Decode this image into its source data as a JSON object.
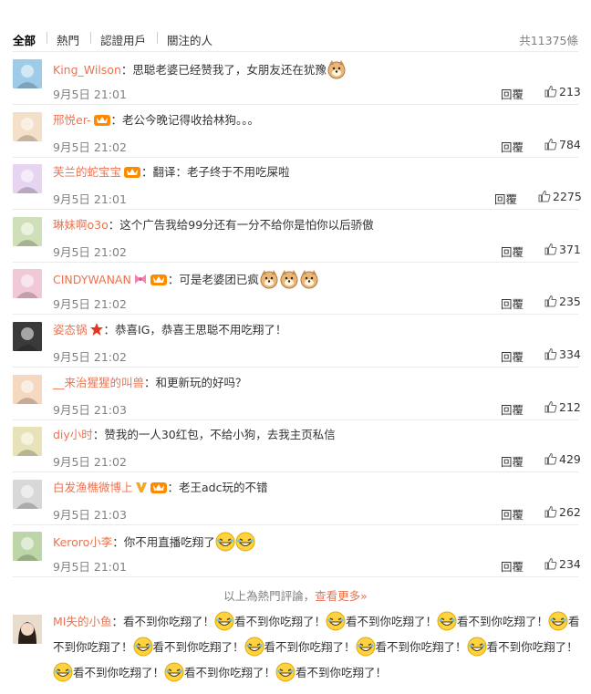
{
  "tabs": [
    "全部",
    "熱門",
    "認證用戶",
    "關注的人"
  ],
  "total": "共11375條",
  "reply_label": "回覆",
  "comments": [
    {
      "user": "King_Wilson",
      "text": "：思聪老婆已经赞我了，女朋友还在犹豫",
      "emojis": 1,
      "badges": [],
      "time": "9月5日 21:01",
      "likes": "213"
    },
    {
      "user": "邢悦er-",
      "text": "：老公今晚记得收拾林狗。。。",
      "emojis": 0,
      "badges": [
        "vip"
      ],
      "time": "9月5日 21:02",
      "likes": "784"
    },
    {
      "user": "芙兰的蛇宝宝",
      "text": "：翻译：老子终于不用吃屎啦",
      "emojis": 0,
      "badges": [
        "vip"
      ],
      "time": "9月5日 21:01",
      "likes": "2275"
    },
    {
      "user": "琳妹啊o3o",
      "text": "：这个广告我给99分还有一分不给你是怕你以后骄傲",
      "emojis": 0,
      "badges": [],
      "time": "9月5日 21:02",
      "likes": "371"
    },
    {
      "user": "CINDYWANAN",
      "text": "：可是老婆团已疯",
      "emojis": 3,
      "badges": [
        "bow",
        "vip"
      ],
      "time": "9月5日 21:02",
      "likes": "235"
    },
    {
      "user": "姿态锅",
      "text": "：恭喜IG，恭喜王思聪不用吃翔了！",
      "emojis": 0,
      "badges": [
        "star"
      ],
      "time": "9月5日 21:02",
      "likes": "334"
    },
    {
      "user": "__来治猩猩的叫兽",
      "text": "：和更新玩的好吗？",
      "emojis": 0,
      "badges": [],
      "time": "9月5日 21:03",
      "likes": "212"
    },
    {
      "user": "diy小时",
      "text": "：赞我的一人30红包，不给小狗，去我主页私信",
      "emojis": 0,
      "badges": [],
      "time": "9月5日 21:02",
      "likes": "429"
    },
    {
      "user": "白发渔樵微博上",
      "text": "：老王adc玩的不错",
      "emojis": 0,
      "badges": [
        "v",
        "vip"
      ],
      "time": "9月5日 21:03",
      "likes": "262"
    },
    {
      "user": "Keroro小李",
      "text": "：你不用直播吃翔了",
      "emojis": 2,
      "badges": [],
      "time": "9月5日 21:01",
      "likes": "234"
    }
  ],
  "more_prefix": "以上為熱門評論，",
  "more_link": "查看更多»",
  "last_comment": {
    "user": "MI失的小鱼",
    "prefix": "：看不到你吃翔了！",
    "phrase": "看不到你吃翔了！",
    "phrase_count": 11
  },
  "colors": {
    "username": "#eb7350",
    "meta": "#808080",
    "text": "#333333"
  }
}
